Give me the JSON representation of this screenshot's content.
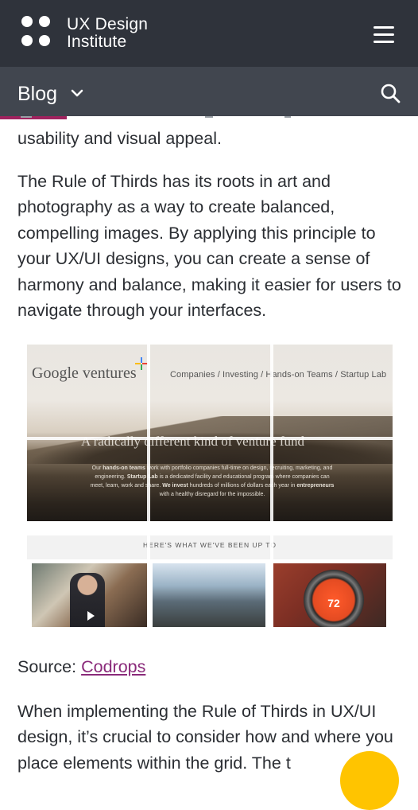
{
  "header": {
    "brand_line1": "UX Design",
    "brand_line2": "Institute",
    "menu_icon": "hamburger-icon",
    "section_label": "Blog",
    "dropdown_icon": "chevron-down-icon",
    "search_icon": "search-icon",
    "bg_color": "#2f333b",
    "subbar_color": "#41464f",
    "accent_color": "#a0235f"
  },
  "article": {
    "para0": "usability and visual appeal.",
    "para1": "The Rule of Thirds has its roots in art and photography as a way to create balanced, compelling images. By applying this principle to your UX/UI designs, you can create a sense of harmony and balance, making it easier for users to navigate through your interfaces.",
    "source_label": "Source:",
    "source_link": "Codrops",
    "para2": "When implementing the Rule of Thirds in UX/UI design, it’s crucial to consider how and where you place elements within the grid. The t"
  },
  "figure": {
    "logo": "Google ventures",
    "nav": "Companies  /  Investing  /  Hands-on Teams  /  Startup Lab",
    "tagline": "A radically different kind of venture fund",
    "desc_a": "Our ",
    "desc_b": "hands-on teams",
    "desc_c": " work with portfolio companies full-time on design, recruiting, marketing, and engineering. ",
    "desc_d": "Startup Lab",
    "desc_e": " is a dedicated facility and educational program where companies can meet, learn, work and share. ",
    "desc_f": "We invest",
    "desc_g": " hundreds of millions of dollars each year in ",
    "desc_h": "entrepreneurs",
    "desc_i": " with a healthy disregard for the impossible.",
    "band": "HERE'S WHAT WE'VE BEEN UP TO",
    "thermostat_value": "72"
  },
  "chat_button_color": "#ffc400"
}
